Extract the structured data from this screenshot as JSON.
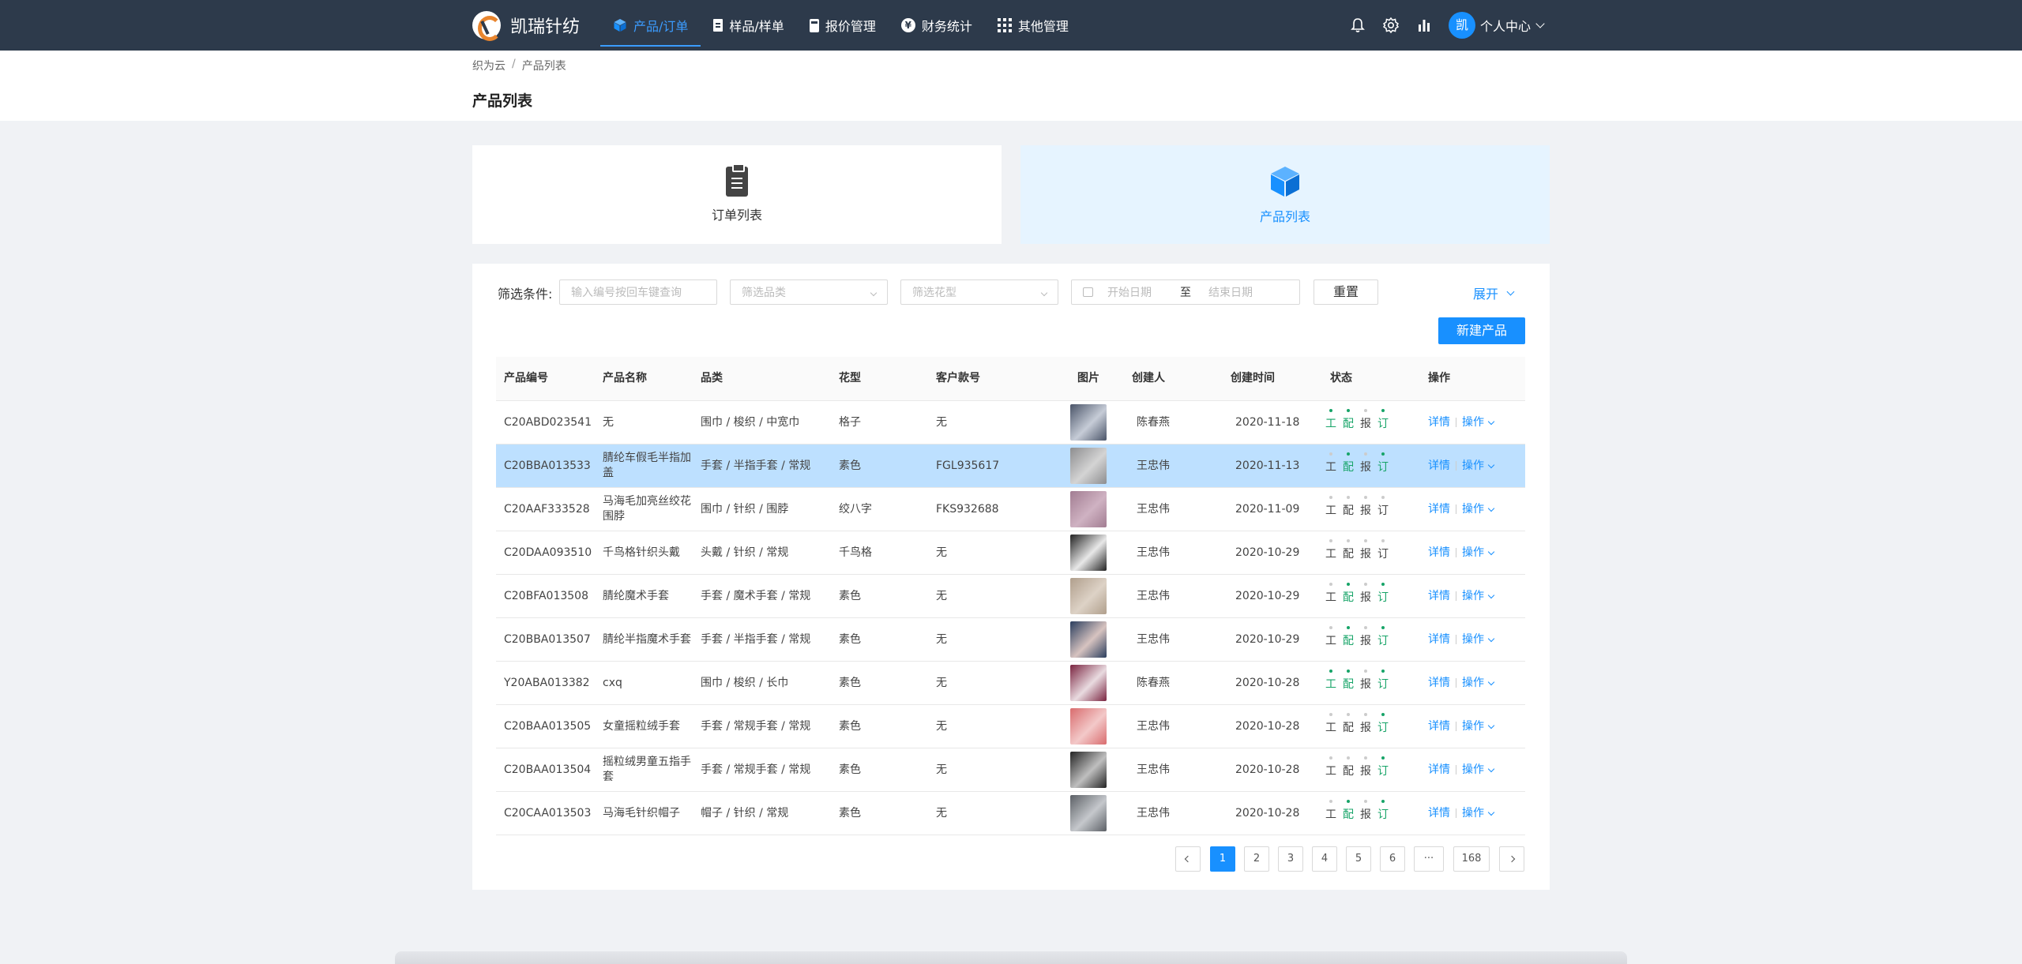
{
  "app": {
    "name": "凯瑞针纺"
  },
  "nav": {
    "items": [
      {
        "label": "产品/订单",
        "icon": "cube-icon",
        "active": true
      },
      {
        "label": "样品/样单",
        "icon": "clipboard-icon",
        "active": false
      },
      {
        "label": "报价管理",
        "icon": "calculator-icon",
        "active": false
      },
      {
        "label": "财务统计",
        "icon": "yen-coin-icon",
        "active": false
      },
      {
        "label": "其他管理",
        "icon": "grid-icon",
        "active": false
      }
    ],
    "user": {
      "avatar": "凯",
      "label": "个人中心"
    }
  },
  "breadcrumb": [
    "织为云",
    "产品列表"
  ],
  "page_title": "产品列表",
  "cards": [
    {
      "label": "订单列表",
      "icon": "clipboard-icon",
      "active": false
    },
    {
      "label": "产品列表",
      "icon": "cube-icon",
      "active": true
    }
  ],
  "filter": {
    "label": "筛选条件:",
    "search_placeholder": "输入编号按回车键查询",
    "category_placeholder": "筛选品类",
    "pattern_placeholder": "筛选花型",
    "start_placeholder": "开始日期",
    "to_label": "至",
    "end_placeholder": "结束日期",
    "reset_label": "重置",
    "expand_label": "展开"
  },
  "new_button_label": "新建产品",
  "table": {
    "columns": [
      "产品编号",
      "产品名称",
      "品类",
      "花型",
      "客户款号",
      "图片",
      "创建人",
      "创建时间",
      "状态",
      "操作"
    ],
    "status_labels": [
      "工",
      "配",
      "报",
      "订"
    ],
    "detail_label": "详情",
    "ops_label": "操作",
    "rows": [
      {
        "code": "C20ABD023541",
        "name": "无",
        "category": "围巾 / 梭织 / 中宽巾",
        "pattern": "格子",
        "client_no": "无",
        "creator": "陈春燕",
        "date": "2020-11-18",
        "status": [
          true,
          true,
          false,
          true
        ],
        "thumb": [
          "#4a5468",
          "#c6ccd7"
        ],
        "selected": false
      },
      {
        "code": "C20BBA013533",
        "name": "腈纶车假毛半指加盖",
        "category": "手套 / 半指手套 / 常规",
        "pattern": "素色",
        "client_no": "FGL935617",
        "creator": "王忠伟",
        "date": "2020-11-13",
        "status": [
          false,
          true,
          false,
          true
        ],
        "thumb": [
          "#8d8d8f",
          "#d4d4d4"
        ],
        "selected": true
      },
      {
        "code": "C20AAF333528",
        "name": "马海毛加亮丝绞花围脖",
        "category": "围巾 / 针织 / 围脖",
        "pattern": "绞八字",
        "client_no": "FKS932688",
        "creator": "王忠伟",
        "date": "2020-11-09",
        "status": [
          false,
          false,
          false,
          false
        ],
        "thumb": [
          "#a27d92",
          "#cfb2c2"
        ],
        "selected": false
      },
      {
        "code": "C20DAA093510",
        "name": "千鸟格针织头戴",
        "category": "头戴 / 针织 / 常规",
        "pattern": "千鸟格",
        "client_no": "无",
        "creator": "王忠伟",
        "date": "2020-10-29",
        "status": [
          false,
          false,
          false,
          false
        ],
        "thumb": [
          "#222222",
          "#e8e8e8"
        ],
        "selected": false
      },
      {
        "code": "C20BFA013508",
        "name": "腈纶魔术手套",
        "category": "手套 / 魔术手套 / 常规",
        "pattern": "素色",
        "client_no": "无",
        "creator": "王忠伟",
        "date": "2020-10-29",
        "status": [
          false,
          true,
          false,
          true
        ],
        "thumb": [
          "#b09f8c",
          "#ddd2c6"
        ],
        "selected": false
      },
      {
        "code": "C20BBA013507",
        "name": "腈纶半指魔术手套",
        "category": "手套 / 半指手套 / 常规",
        "pattern": "素色",
        "client_no": "无",
        "creator": "王忠伟",
        "date": "2020-10-29",
        "status": [
          false,
          true,
          false,
          true
        ],
        "thumb": [
          "#2b3e5e",
          "#d7c3c0"
        ],
        "selected": false
      },
      {
        "code": "Y20ABA013382",
        "name": "cxq",
        "category": "围巾 / 梭织 / 长巾",
        "pattern": "素色",
        "client_no": "无",
        "creator": "陈春燕",
        "date": "2020-10-28",
        "status": [
          true,
          true,
          false,
          true
        ],
        "thumb": [
          "#7a2440",
          "#e9dbe0"
        ],
        "selected": false
      },
      {
        "code": "C20BAA013505",
        "name": "女童摇粒绒手套",
        "category": "手套 / 常规手套 / 常规",
        "pattern": "素色",
        "client_no": "无",
        "creator": "王忠伟",
        "date": "2020-10-28",
        "status": [
          false,
          false,
          false,
          true
        ],
        "thumb": [
          "#d96c6e",
          "#f3c9c9"
        ],
        "selected": false
      },
      {
        "code": "C20BAA013504",
        "name": "摇粒绒男童五指手套",
        "category": "手套 / 常规手套 / 常规",
        "pattern": "素色",
        "client_no": "无",
        "creator": "王忠伟",
        "date": "2020-10-28",
        "status": [
          false,
          false,
          false,
          true
        ],
        "thumb": [
          "#242424",
          "#bfbfbf"
        ],
        "selected": false
      },
      {
        "code": "C20CAA013503",
        "name": "马海毛针织帽子",
        "category": "帽子 / 针织 / 常规",
        "pattern": "素色",
        "client_no": "无",
        "creator": "王忠伟",
        "date": "2020-10-28",
        "status": [
          false,
          true,
          false,
          true
        ],
        "thumb": [
          "#5c6066",
          "#c5c8cc"
        ],
        "selected": false
      }
    ]
  },
  "pagination": {
    "pages": [
      "1",
      "2",
      "3",
      "4",
      "5",
      "6"
    ],
    "ellipsis": "···",
    "last": "168",
    "current": "1"
  },
  "colors": {
    "nav_bg": "#2d3a4b",
    "accent": "#1890ff",
    "status_on": "#17a468",
    "selected_row": "#bde0ff"
  }
}
